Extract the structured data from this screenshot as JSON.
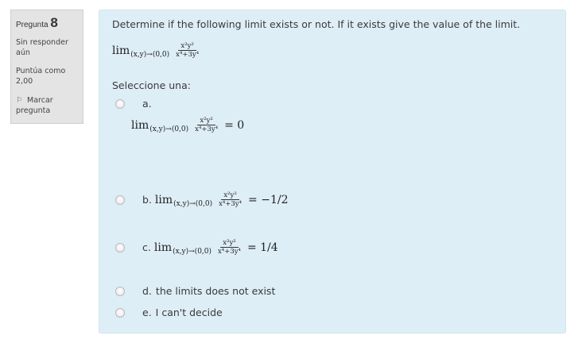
{
  "info": {
    "question_label": "Pregunta",
    "question_number": "8",
    "state": "Sin responder aún",
    "grade": "Puntúa como 2,00",
    "flag": "Marcar pregunta",
    "flag_icon": "flag-icon"
  },
  "question": {
    "text": "Determine if the following limit exists or not. If it exists give the value of the limit.",
    "lim": "lim",
    "sub": "(x,y)→(0,0)",
    "num": "x²y²",
    "den": "x⁴+3y⁴"
  },
  "prompt": "Seleccione una:",
  "options": [
    {
      "letter": "a.",
      "rhs": "= 0"
    },
    {
      "letter": "b.",
      "rhs": "= −1/2"
    },
    {
      "letter": "c.",
      "rhs": "= 1/4"
    },
    {
      "letter": "d.",
      "text": "the limits does not exist"
    },
    {
      "letter": "e.",
      "text": "I can't decide"
    }
  ]
}
